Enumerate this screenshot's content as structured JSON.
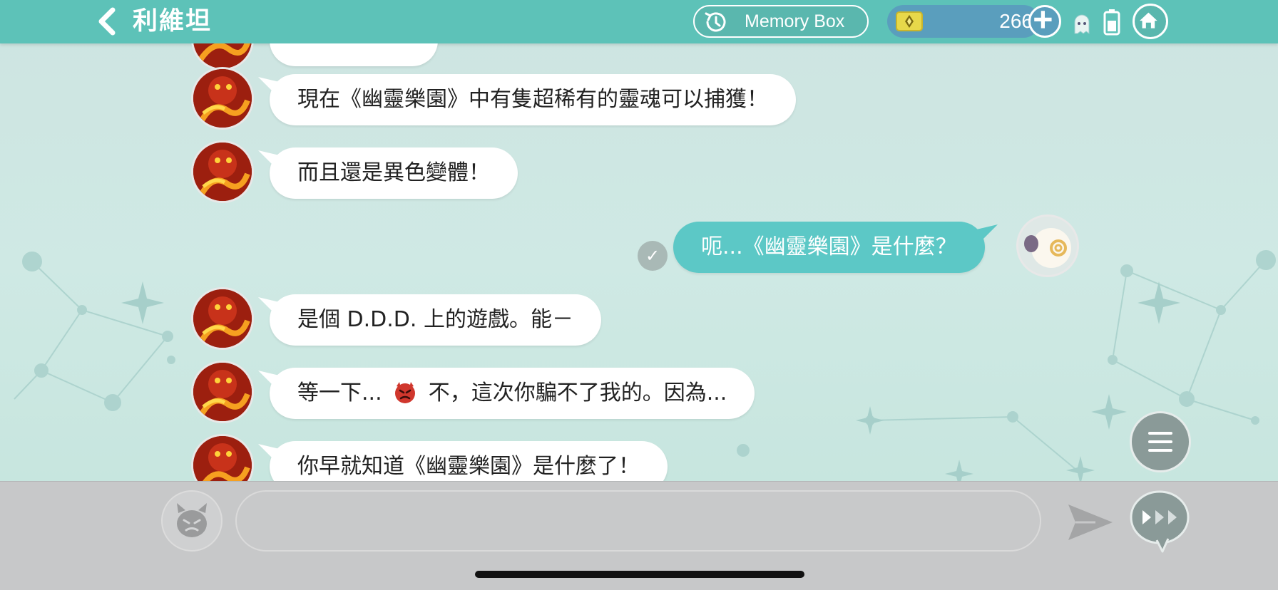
{
  "header": {
    "back_icon": "chevron-left-icon",
    "title": "利維坦",
    "memory_box": {
      "icon": "history-clock-icon",
      "label": "Memory Box"
    },
    "currency": {
      "icon": "gem-icon",
      "amount": "266",
      "add_icon": "plus-icon"
    },
    "status_icons": [
      "ghost-icon",
      "battery-icon"
    ],
    "home_icon": "home-icon",
    "colors": {
      "bar": "#5dc2b8",
      "currency_pill": "#5a9ebd"
    }
  },
  "chat": {
    "partner_avatar": "leviathan-dragon-avatar",
    "user_avatar": "sheep-avatar",
    "messages": [
      {
        "from": "partner",
        "text": ""
      },
      {
        "from": "partner",
        "text": "現在《幽靈樂園》中有隻超稀有的靈魂可以捕獲！"
      },
      {
        "from": "partner",
        "text": "而且還是異色變體！"
      },
      {
        "from": "user",
        "text": "呃...《幽靈樂園》是什麼？",
        "read_mark": "✓"
      },
      {
        "from": "partner",
        "text": "是個 D.D.D. 上的遊戲。能－"
      },
      {
        "from": "partner",
        "text_before": "等一下...",
        "emoji": "angry-devil-emoji",
        "text_after": "不，這次你騙不了我的。因為..."
      },
      {
        "from": "partner",
        "text": "你早就知道《幽靈樂園》是什麼了！"
      }
    ],
    "colors": {
      "partner_bubble": "#ffffff",
      "user_bubble": "#5cc8c6"
    }
  },
  "menu_icon": "hamburger-menu-icon",
  "composer": {
    "emoji_icon": "devil-face-icon",
    "input_value": "",
    "input_placeholder": "",
    "send_icon": "paper-plane-send-icon",
    "fast_forward_icon": "fast-forward-bubble-icon"
  }
}
